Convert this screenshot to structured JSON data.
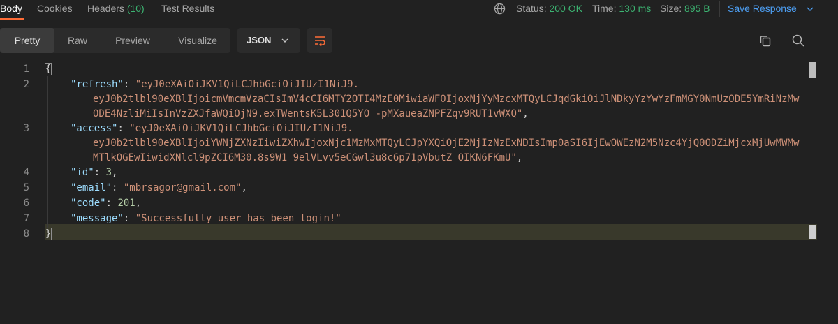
{
  "tabs": [
    {
      "label": "Body"
    },
    {
      "label": "Cookies"
    },
    {
      "label": "Headers",
      "count": "(10)"
    },
    {
      "label": "Test Results"
    }
  ],
  "status": {
    "status_label": "Status:",
    "status_value": "200 OK",
    "time_label": "Time:",
    "time_value": "130 ms",
    "size_label": "Size:",
    "size_value": "895 B"
  },
  "save_response": "Save Response",
  "view_modes": [
    "Pretty",
    "Raw",
    "Preview",
    "Visualize"
  ],
  "format": "JSON",
  "icons": {
    "globe": "globe-icon",
    "chevron": "chevron-down-icon",
    "wrap": "wrap-lines-icon",
    "copy": "copy-icon",
    "search": "search-icon"
  },
  "colors": {
    "accent": "#ff6c37",
    "status_ok": "#3cb371",
    "link": "#4d9ff3",
    "json_key": "#9cdcfe",
    "json_string": "#ce9178",
    "json_number": "#b5cea8"
  },
  "response": {
    "line_numbers": [
      "1",
      "2",
      "3",
      "4",
      "5",
      "6",
      "7",
      "8"
    ],
    "open_brace": "{",
    "close_brace": "}",
    "refresh_key": "\"refresh\"",
    "refresh_value_1": "\"eyJ0eXAiOiJKV1QiLCJhbGciOiJIUzI1NiJ9.",
    "refresh_value_2": "eyJ0b2tlbl90eXBlIjoicmVmcmVzaCIsImV4cCI6MTY2OTI4MzE0MiwiaWF0IjoxNjYyMzcxMTQyLCJqdGkiOiJlNDkyYzYwYzFmMGY0NmUzODE5YmRiNzMw",
    "refresh_value_3": "ODE4NzliMiIsInVzZXJfaWQiOjN9.exTWentsK5L301Q5YO_-pMXaueaZNPFZqv9RUT1vWXQ\"",
    "access_key": "\"access\"",
    "access_value_1": "\"eyJ0eXAiOiJKV1QiLCJhbGciOiJIUzI1NiJ9.",
    "access_value_2": "eyJ0b2tlbl90eXBlIjoiYWNjZXNzIiwiZXhwIjoxNjc1MzMxMTQyLCJpYXQiOjE2NjIzNzExNDIsImp0aSI6IjEwOWEzN2M5Nzc4YjQ0ODZiMjcxMjUwMWMw",
    "access_value_3": "MTlkOGEwIiwidXNlcl9pZCI6M30.8s9W1_9elVLvv5eCGwl3u8c6p71pVbutZ_OIKN6FKmU\"",
    "id_key": "\"id\"",
    "id_value": "3",
    "email_key": "\"email\"",
    "email_value": "\"mbrsagor@gmail.com\"",
    "code_key": "\"code\"",
    "code_value": "201",
    "message_key": "\"message\"",
    "message_value": "\"Successfully user has been login!\""
  }
}
